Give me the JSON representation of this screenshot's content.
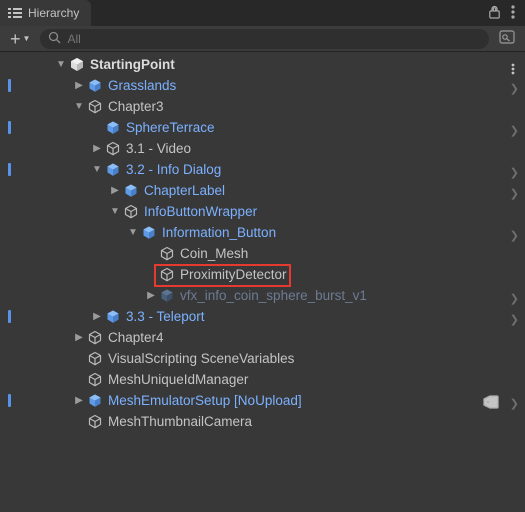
{
  "panel": {
    "title": "Hierarchy"
  },
  "toolbar": {
    "add_label": "+",
    "search_placeholder": "All"
  },
  "rows": [
    {
      "id": "scene",
      "depth": 2,
      "marker": false,
      "expand": "down",
      "icon": "scene",
      "label": "StartingPoint",
      "style": "bold",
      "rightMenu": true
    },
    {
      "id": "grasslands",
      "depth": 3,
      "marker": true,
      "expand": "right",
      "icon": "prefab",
      "label": "Grasslands",
      "style": "prefab",
      "drill": true
    },
    {
      "id": "chapter3",
      "depth": 3,
      "marker": false,
      "expand": "down",
      "icon": "go",
      "label": "Chapter3"
    },
    {
      "id": "sphereterr",
      "depth": 4,
      "marker": true,
      "expand": "none",
      "icon": "prefab",
      "label": "SphereTerrace",
      "style": "prefab",
      "drill": true
    },
    {
      "id": "video",
      "depth": 4,
      "marker": false,
      "expand": "right",
      "icon": "go",
      "label": "3.1 - Video"
    },
    {
      "id": "info",
      "depth": 4,
      "marker": true,
      "expand": "down",
      "icon": "prefab",
      "label": "3.2 - Info Dialog",
      "style": "prefab",
      "drill": true
    },
    {
      "id": "chlabel",
      "depth": 5,
      "marker": false,
      "expand": "right",
      "icon": "prefab",
      "label": "ChapterLabel",
      "style": "prefab",
      "drill": true
    },
    {
      "id": "ibw",
      "depth": 5,
      "marker": false,
      "expand": "down",
      "icon": "go",
      "label": "InfoButtonWrapper",
      "style": "prefab"
    },
    {
      "id": "ibtn",
      "depth": 6,
      "marker": false,
      "expand": "down",
      "icon": "prefab",
      "label": "Information_Button",
      "style": "prefab",
      "drill": true
    },
    {
      "id": "coin",
      "depth": 7,
      "marker": false,
      "expand": "none",
      "icon": "go",
      "label": "Coin_Mesh"
    },
    {
      "id": "prox",
      "depth": 7,
      "marker": false,
      "expand": "none",
      "icon": "go",
      "label": "ProximityDetector"
    },
    {
      "id": "vfx",
      "depth": 7,
      "marker": false,
      "expand": "right",
      "icon": "mprefab",
      "label": "vfx_info_coin_sphere_burst_v1",
      "style": "muted",
      "drill": true
    },
    {
      "id": "tele",
      "depth": 4,
      "marker": true,
      "expand": "right",
      "icon": "prefab",
      "label": "3.3 - Teleport",
      "style": "prefab",
      "drill": true
    },
    {
      "id": "chapter4",
      "depth": 3,
      "marker": false,
      "expand": "right",
      "icon": "go",
      "label": "Chapter4"
    },
    {
      "id": "vsvars",
      "depth": 3,
      "marker": false,
      "expand": "none",
      "icon": "go",
      "label": "VisualScripting SceneVariables"
    },
    {
      "id": "uidmgr",
      "depth": 3,
      "marker": false,
      "expand": "none",
      "icon": "go",
      "label": "MeshUniqueIdManager"
    },
    {
      "id": "emulator",
      "depth": 3,
      "marker": true,
      "expand": "right",
      "icon": "prefab",
      "label": "MeshEmulatorSetup [NoUpload]",
      "style": "prefab",
      "drill": true,
      "tag": true
    },
    {
      "id": "thumbcam",
      "depth": 3,
      "marker": false,
      "expand": "none",
      "icon": "go",
      "label": "MeshThumbnailCamera"
    }
  ],
  "highlight": {
    "target_id": "prox"
  }
}
